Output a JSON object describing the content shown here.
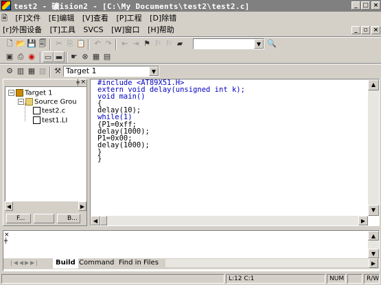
{
  "window": {
    "title": "test2  - 礦ision2 - [C:\\My Documents\\test2\\test2.c]",
    "minimize": "_",
    "maximize": "□",
    "close": "×"
  },
  "menu1": [
    "[F]文件",
    "[E]编辑",
    "[V]查看",
    "[P]工程",
    "[D]除错"
  ],
  "menu2": [
    "[r]外围设备",
    "[T]工具",
    "SVCS",
    "[W]窗口",
    "[H]帮助"
  ],
  "target_combo": {
    "value": "Target 1"
  },
  "tree": {
    "root": "Target 1",
    "group": "Source Grou",
    "files": [
      "test2.c",
      "test1.LI"
    ]
  },
  "proj_tabs": [
    "F...",
    "",
    "B..."
  ],
  "code": [
    "#include <AT89X51.H>",
    "extern void delay(unsigned int k);",
    "void main()",
    "{",
    "delay(10);",
    "while(1)",
    "{P1=0xff;",
    "delay(1000);",
    "P1=0x00;",
    "delay(1000);",
    "}",
    "}"
  ],
  "output_tabs": [
    "Build",
    "Command",
    "Find in Files"
  ],
  "status": {
    "position": "L:12 C:1",
    "mode1": "NUM",
    "mode2": "R/W"
  }
}
